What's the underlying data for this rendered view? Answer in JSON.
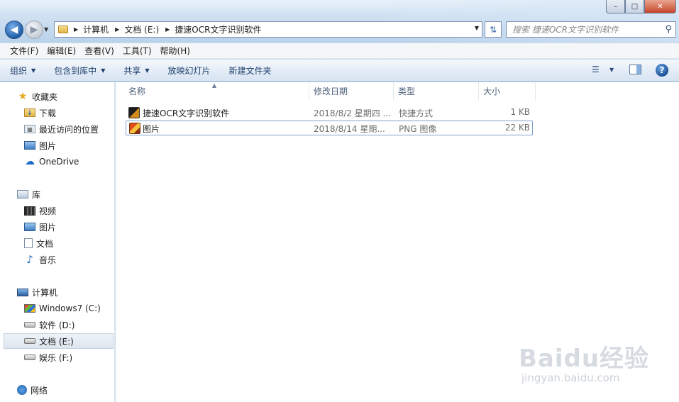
{
  "window": {
    "controls": {
      "minimize": "–",
      "maximize": "□",
      "close": "✕"
    }
  },
  "nav": {
    "back_icon": "arrow-left",
    "forward_icon": "arrow-right"
  },
  "address": {
    "crumbs": [
      "计算机",
      "文档 (E:)",
      "捷速OCR文字识别软件"
    ]
  },
  "search": {
    "placeholder": "搜索 捷速OCR文字识别软件"
  },
  "menu": [
    "文件(F)",
    "编辑(E)",
    "查看(V)",
    "工具(T)",
    "帮助(H)"
  ],
  "toolbar": {
    "organize": "组织",
    "include_library": "包含到库中",
    "share": "共享",
    "slideshow": "放映幻灯片",
    "new_folder": "新建文件夹",
    "help": "?"
  },
  "sidebar": {
    "favorites": {
      "label": "收藏夹",
      "items": [
        "下载",
        "最近访问的位置",
        "图片",
        "OneDrive"
      ]
    },
    "libraries": {
      "label": "库",
      "items": [
        "视频",
        "图片",
        "文档",
        "音乐"
      ]
    },
    "computer": {
      "label": "计算机",
      "items": [
        "Windows7 (C:)",
        "软件 (D:)",
        "文档 (E:)",
        "娱乐 (F:)"
      ],
      "selected": "文档 (E:)"
    },
    "network": {
      "label": "网络"
    }
  },
  "columns": {
    "name": "名称",
    "modified": "修改日期",
    "type": "类型",
    "size": "大小"
  },
  "files": [
    {
      "name": "捷速OCR文字识别软件",
      "modified": "2018/8/2 星期四 ...",
      "type": "快捷方式",
      "size": "1 KB"
    },
    {
      "name": "图片",
      "modified": "2018/8/14 星期...",
      "type": "PNG 图像",
      "size": "22 KB"
    }
  ],
  "watermark": {
    "brand": "Baidu经验",
    "url": "jingyan.baidu.com"
  }
}
